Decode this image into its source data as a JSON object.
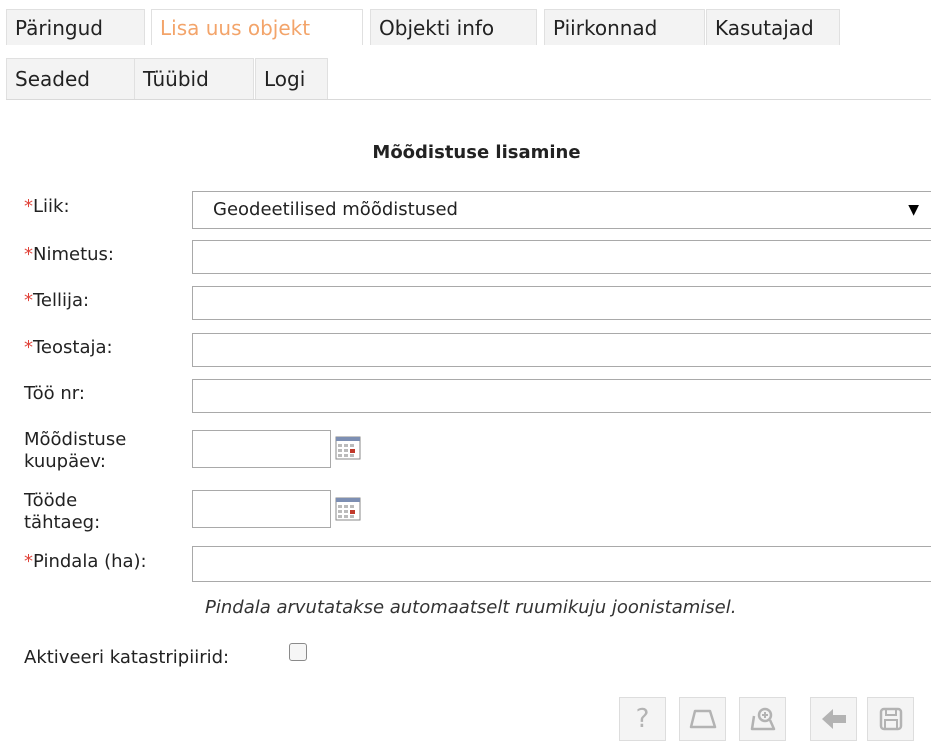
{
  "tabs": [
    {
      "label": "Päringud",
      "active": false
    },
    {
      "label": "Lisa uus objekt",
      "active": true
    },
    {
      "label": "Objekti info",
      "active": false
    },
    {
      "label": "Piirkonnad",
      "active": false
    },
    {
      "label": "Kasutajad",
      "active": false
    },
    {
      "label": "Seaded",
      "active": false
    },
    {
      "label": "Tüübid",
      "active": false
    },
    {
      "label": "Logi",
      "active": false
    }
  ],
  "form": {
    "title": "Mõõdistuse lisamine",
    "required_mark": "*",
    "liik": {
      "label": "Liik:",
      "value": "Geodeetilised mõõdistused"
    },
    "nimetus": {
      "label": "Nimetus:",
      "value": ""
    },
    "tellija": {
      "label": "Tellija:",
      "value": ""
    },
    "teostaja": {
      "label": "Teostaja:",
      "value": ""
    },
    "too_nr": {
      "label": "Töö nr:",
      "value": ""
    },
    "moodistuse_kuupaev": {
      "label_line1": "Mõõdistuse",
      "label_line2": "kuupäev:",
      "value": ""
    },
    "toode_tahtaeg": {
      "label_line1": "Tööde",
      "label_line2": "tähtaeg:",
      "value": ""
    },
    "pindala": {
      "label": "Pindala (ha):",
      "value": ""
    },
    "hint": "Pindala arvutatakse automaatselt ruumikuju joonistamisel.",
    "aktiveeri": {
      "label": "Aktiveeri katastripiirid:",
      "checked": false
    }
  },
  "toolbar": {
    "help_glyph": "?",
    "icons": [
      "help-icon",
      "polygon-draw-icon",
      "zoom-polygon-icon",
      "back-arrow-icon",
      "save-icon"
    ]
  },
  "colors": {
    "active_tab": "#f3a46a",
    "required": "#e0433a",
    "tab_bg": "#f3f3f3"
  }
}
